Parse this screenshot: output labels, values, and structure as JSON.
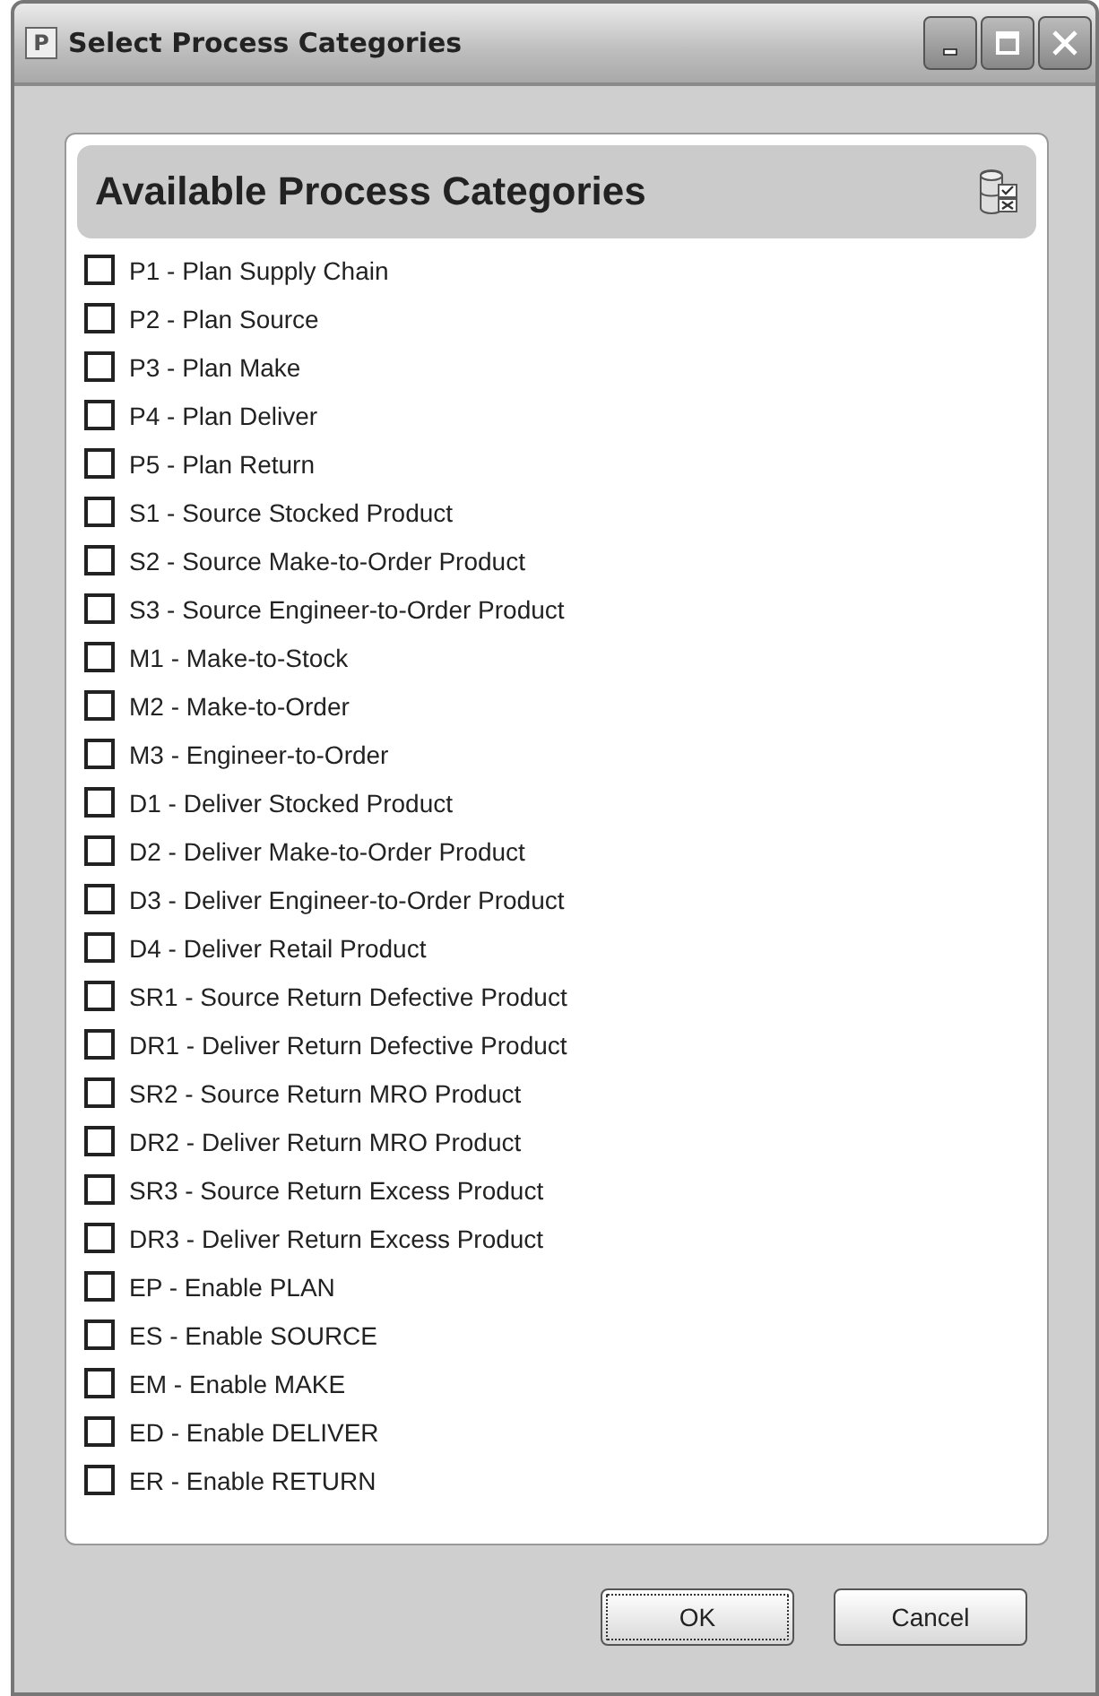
{
  "window": {
    "icon": "P",
    "title": "Select Process Categories"
  },
  "panel": {
    "title": "Available Process Categories"
  },
  "items": [
    {
      "label": "P1 - Plan Supply Chain",
      "checked": false
    },
    {
      "label": "P2 - Plan Source",
      "checked": false
    },
    {
      "label": "P3 - Plan Make",
      "checked": false
    },
    {
      "label": "P4 - Plan Deliver",
      "checked": false
    },
    {
      "label": "P5 - Plan Return",
      "checked": false
    },
    {
      "label": "S1 - Source Stocked Product",
      "checked": false
    },
    {
      "label": "S2 - Source Make-to-Order Product",
      "checked": false
    },
    {
      "label": "S3 - Source Engineer-to-Order Product",
      "checked": false
    },
    {
      "label": "M1 - Make-to-Stock",
      "checked": false
    },
    {
      "label": "M2 - Make-to-Order",
      "checked": false
    },
    {
      "label": "M3 - Engineer-to-Order",
      "checked": false
    },
    {
      "label": "D1 - Deliver Stocked Product",
      "checked": false
    },
    {
      "label": "D2 - Deliver Make-to-Order Product",
      "checked": false
    },
    {
      "label": "D3 - Deliver Engineer-to-Order Product",
      "checked": false
    },
    {
      "label": "D4 - Deliver Retail Product",
      "checked": false
    },
    {
      "label": "SR1 - Source Return Defective Product",
      "checked": false
    },
    {
      "label": "DR1 - Deliver Return Defective Product",
      "checked": false
    },
    {
      "label": "SR2 - Source Return MRO Product",
      "checked": false
    },
    {
      "label": "DR2 - Deliver Return MRO Product",
      "checked": false
    },
    {
      "label": "SR3 - Source Return Excess Product",
      "checked": false
    },
    {
      "label": "DR3 - Deliver Return Excess Product",
      "checked": false
    },
    {
      "label": "EP - Enable PLAN",
      "checked": false
    },
    {
      "label": "ES - Enable SOURCE",
      "checked": false
    },
    {
      "label": "EM - Enable MAKE",
      "checked": false
    },
    {
      "label": "ED - Enable DELIVER",
      "checked": false
    },
    {
      "label": "ER - Enable RETURN",
      "checked": false
    }
  ],
  "buttons": [
    {
      "label": "OK",
      "focused": true
    },
    {
      "label": "Cancel",
      "focused": false
    }
  ]
}
